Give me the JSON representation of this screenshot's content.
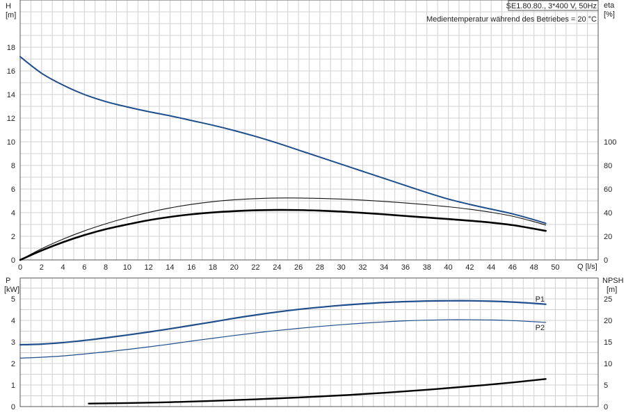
{
  "chart_data": [
    {
      "type": "line",
      "model_label": "SE1.80.80., 3*400 V, 50Hz",
      "note": "Medientemperatur während des Betriebes = 20 °C",
      "left_axis": {
        "label": "H",
        "unit": "[m]",
        "range": [
          0,
          20
        ],
        "ticks": [
          0,
          2,
          4,
          6,
          8,
          10,
          12,
          14,
          16,
          18
        ]
      },
      "right_axis": {
        "label": "eta",
        "unit": "[%]",
        "range": [
          0,
          110
        ],
        "ticks": [
          0,
          20,
          40,
          60,
          80,
          100
        ]
      },
      "x_axis": {
        "label": "Q [l/s]",
        "range": [
          0,
          54
        ],
        "ticks": [
          0,
          2,
          4,
          6,
          8,
          10,
          12,
          14,
          16,
          18,
          20,
          22,
          24,
          26,
          28,
          30,
          32,
          34,
          36,
          38,
          40,
          42,
          44,
          46,
          48,
          50
        ]
      },
      "grid": true,
      "series": [
        {
          "key": "head",
          "axis": "left",
          "color": "#1f4e8c",
          "x": [
            0,
            2,
            4,
            6,
            8,
            10,
            12,
            14,
            16,
            18,
            20,
            22,
            24,
            26,
            28,
            30,
            32,
            34,
            36,
            38,
            40,
            42,
            44,
            46,
            48,
            49.1
          ],
          "y": [
            17.2,
            15.8,
            14.8,
            14.0,
            13.4,
            12.95,
            12.55,
            12.2,
            11.8,
            11.4,
            10.95,
            10.45,
            9.9,
            9.3,
            8.7,
            8.1,
            7.5,
            6.9,
            6.3,
            5.7,
            5.15,
            4.7,
            4.3,
            3.9,
            3.4,
            3.1
          ]
        },
        {
          "key": "eta-thin",
          "axis": "right",
          "color": "#111111",
          "x": [
            0,
            2,
            4,
            6,
            8,
            10,
            12,
            14,
            16,
            18,
            20,
            22,
            24,
            26,
            28,
            30,
            32,
            34,
            36,
            38,
            40,
            42,
            44,
            46,
            48,
            49.1
          ],
          "y": [
            0,
            9.5,
            17.6,
            24.6,
            30.6,
            35.8,
            40.2,
            44.0,
            47.0,
            49.3,
            50.9,
            51.9,
            52.4,
            52.4,
            52.1,
            51.5,
            50.6,
            49.5,
            48.2,
            46.7,
            45.0,
            42.9,
            40.3,
            37.0,
            32.4,
            29.5
          ]
        },
        {
          "key": "eta-thick",
          "axis": "right",
          "color": "#000000",
          "x": [
            0,
            2,
            4,
            6,
            8,
            10,
            12,
            14,
            16,
            18,
            20,
            22,
            24,
            26,
            28,
            30,
            32,
            34,
            36,
            38,
            40,
            42,
            44,
            46,
            48,
            49.1
          ],
          "y": [
            0,
            8.0,
            15.0,
            21.0,
            26.0,
            30.0,
            33.6,
            36.4,
            38.6,
            40.2,
            41.3,
            42.0,
            42.3,
            42.2,
            41.7,
            40.9,
            39.8,
            38.6,
            37.2,
            35.9,
            34.6,
            33.2,
            31.6,
            29.5,
            26.4,
            24.6
          ]
        }
      ]
    },
    {
      "type": "line",
      "left_axis": {
        "label": "P",
        "unit": "[kW]",
        "range": [
          0,
          5.5
        ],
        "ticks": [
          0,
          1,
          2,
          3,
          4,
          5
        ]
      },
      "right_axis": {
        "label": "NPSH",
        "unit": "[m]",
        "range": [
          0,
          27.5
        ],
        "ticks": [
          0,
          5,
          10,
          15,
          20,
          25
        ]
      },
      "x_axis": {
        "range": [
          0,
          54
        ]
      },
      "grid": true,
      "series": [
        {
          "name": "P1",
          "key": "p1",
          "axis": "left",
          "color": "#1f4e8c",
          "x": [
            0,
            2,
            4,
            6,
            8,
            10,
            12,
            14,
            16,
            18,
            20,
            22,
            24,
            26,
            28,
            30,
            32,
            34,
            36,
            38,
            40,
            42,
            44,
            46,
            48,
            49.1
          ],
          "y": [
            2.87,
            2.9,
            2.97,
            3.07,
            3.19,
            3.32,
            3.46,
            3.61,
            3.77,
            3.93,
            4.1,
            4.25,
            4.39,
            4.51,
            4.61,
            4.7,
            4.77,
            4.83,
            4.87,
            4.9,
            4.91,
            4.91,
            4.89,
            4.85,
            4.79,
            4.75
          ]
        },
        {
          "name": "P2",
          "key": "p2",
          "axis": "left",
          "color": "#1f4e8c",
          "x": [
            0,
            2,
            4,
            6,
            8,
            10,
            12,
            14,
            16,
            18,
            20,
            22,
            24,
            26,
            28,
            30,
            32,
            34,
            36,
            38,
            40,
            42,
            44,
            46,
            48,
            49.1
          ],
          "y": [
            2.25,
            2.29,
            2.35,
            2.44,
            2.54,
            2.65,
            2.77,
            2.9,
            3.04,
            3.17,
            3.3,
            3.42,
            3.53,
            3.63,
            3.72,
            3.8,
            3.87,
            3.93,
            3.98,
            4.01,
            4.03,
            4.03,
            4.02,
            3.99,
            3.94,
            3.91
          ]
        },
        {
          "key": "npsh",
          "axis": "right",
          "color": "#000000",
          "x": [
            6.4,
            10,
            14,
            18,
            22,
            26,
            30,
            34,
            38,
            42,
            46,
            49.1
          ],
          "y": [
            0.7,
            0.82,
            1.02,
            1.32,
            1.68,
            2.1,
            2.6,
            3.2,
            3.9,
            4.7,
            5.6,
            6.4
          ]
        }
      ]
    }
  ]
}
